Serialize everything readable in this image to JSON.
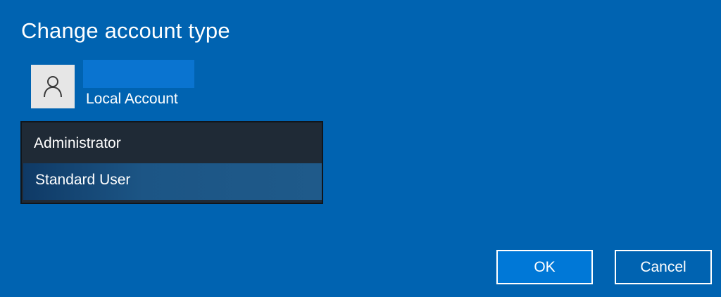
{
  "dialog": {
    "title": "Change account type"
  },
  "account": {
    "avatar_icon": "user-icon",
    "type_label": "Local Account"
  },
  "account_type_list": {
    "options": [
      {
        "label": "Administrator",
        "selected": false
      },
      {
        "label": "Standard User",
        "selected": true
      }
    ]
  },
  "buttons": {
    "ok_label": "OK",
    "cancel_label": "Cancel"
  },
  "colors": {
    "background": "#0063b1",
    "list_background": "#1f2a36",
    "list_selected": "#1f5a8a",
    "ok_button": "#0078d7",
    "avatar_background": "#e6e6e6"
  }
}
